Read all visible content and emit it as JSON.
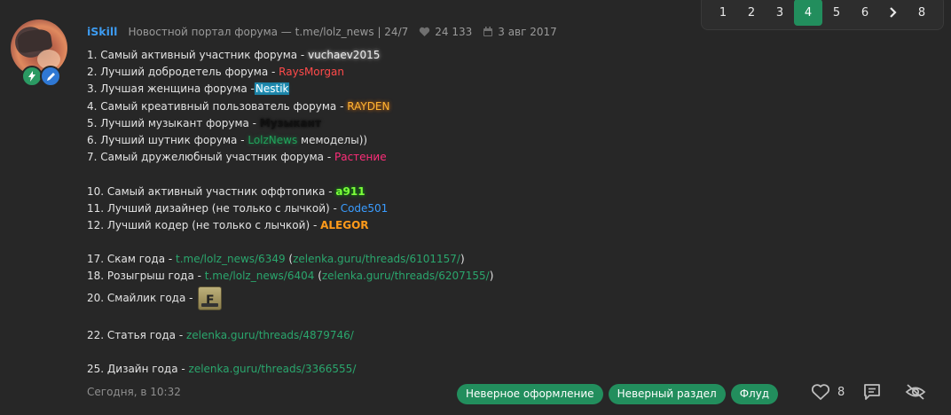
{
  "pagination": {
    "pages": [
      "1",
      "2",
      "3",
      "4",
      "5",
      "6",
      "8"
    ],
    "active": "4",
    "next_icon": "chevron-right-icon"
  },
  "post": {
    "username": "iSkill",
    "title": "Новостной портал форума — t.me/lolz_news | 24/7",
    "likes_total": "24 133",
    "reg_date": "3 авг 2017",
    "time": "Сегодня, в 10:32",
    "likes": "8"
  },
  "lines": {
    "l1_pre": "1. Самый активный участник форума - ",
    "l1_name": "vuchaev2015",
    "l2_pre": "2. Лучший добродетель форума - ",
    "l2_name": "RaysMorgan",
    "l3_pre": "3. Лучшая женщина форума -",
    "l3_name": "Nestik",
    "l4_pre": "4. Самый креативный пользователь форума - ",
    "l4_name": "RAYDEN",
    "l5_pre": "5. Лучший музыкант форума - ",
    "l5_name": "Музыкант",
    "l6_pre": "6. Лучший шутник форума - ",
    "l6_name": "LolzNews",
    "l6_post": " мемоделы))",
    "l7_pre": "7. Самый дружелюбный участник форума - ",
    "l7_name": "Растение",
    "l10_pre": "10. Самый активный участник оффтопика - ",
    "l10_name": "a911",
    "l11_pre": "11. Лучший дизайнер (не только с лычкой) - ",
    "l11_name": "Code501",
    "l12_pre": "12. Лучший кодер (не только с лычкой) - ",
    "l12_name": "ALEGOR",
    "l17_pre": "17. Скам года - ",
    "l17_link1": "t.me/lolz_news/6349",
    "l17_open": " (",
    "l17_link2": "zelenka.guru/threads/6101157/",
    "l17_close": ")",
    "l18_pre": "18. Розыгрыш года - ",
    "l18_link1": "t.me/lolz_news/6404",
    "l18_open": " (",
    "l18_link2": "zelenka.guru/threads/6207155/",
    "l18_close": ")",
    "l20_pre": "20. Смайлик года - ",
    "l20_smiley_letter": "F",
    "l22_pre": "22. Статья года - ",
    "l22_link": "zelenka.guru/threads/4879746/",
    "l25_pre": "25. Дизайн года - ",
    "l25_link": "zelenka.guru/threads/3366555/"
  },
  "tags": [
    "Неверное оформление",
    "Неверный раздел",
    "Флуд"
  ],
  "colors": {
    "accent": "#228e5d",
    "username": "#3d9bf0",
    "link": "#2aa66d",
    "background": "#272727"
  }
}
